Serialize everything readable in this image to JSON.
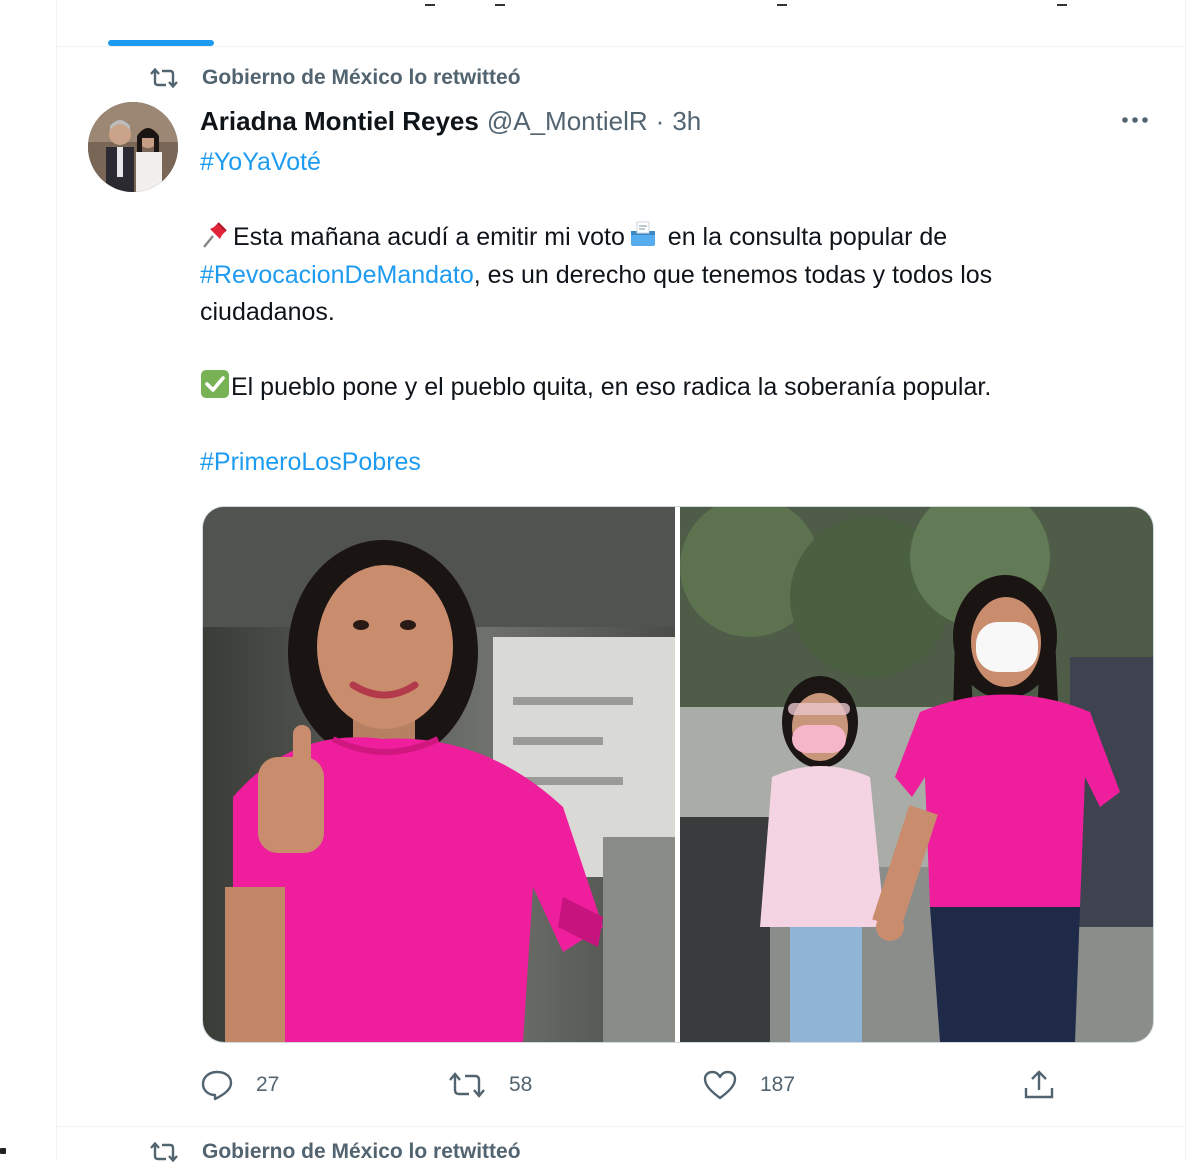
{
  "retweet_context": {
    "text": "Gobierno de México lo retwitteó",
    "icon": "retweet-icon"
  },
  "tweet": {
    "author_name": "Ariadna Montiel Reyes",
    "author_handle": "@A_MontielR",
    "separator": "·",
    "time": "3h",
    "more_icon": "more-icon",
    "hashtag_top": "#YoYaVoté",
    "line1_emoji": "pushpin-icon",
    "line1_text_a": "Esta mañana acudí a emitir mi voto",
    "line1_emoji2": "ballot-box-icon",
    "line1_text_b": " en la consulta popular de",
    "line2_hashtag": "#RevocacionDeMandato",
    "line2_text": ", es un derecho que tenemos todas y todos los",
    "line3_text": "ciudadanos.",
    "line4_emoji": "check-mark-icon",
    "line4_text": "El pueblo pone y el pueblo quita, en eso radica la soberanía popular.",
    "hashtag_bottom": "#PrimeroLosPobres"
  },
  "actions": {
    "reply_count": "27",
    "retweet_count": "58",
    "like_count": "187"
  },
  "next_retweet_context": {
    "text": "Gobierno de México lo retwitteó"
  },
  "colors": {
    "accent": "#1d9bf0",
    "secondary_text": "#536471",
    "primary_text": "#0f1419",
    "border": "#cfd9de"
  }
}
